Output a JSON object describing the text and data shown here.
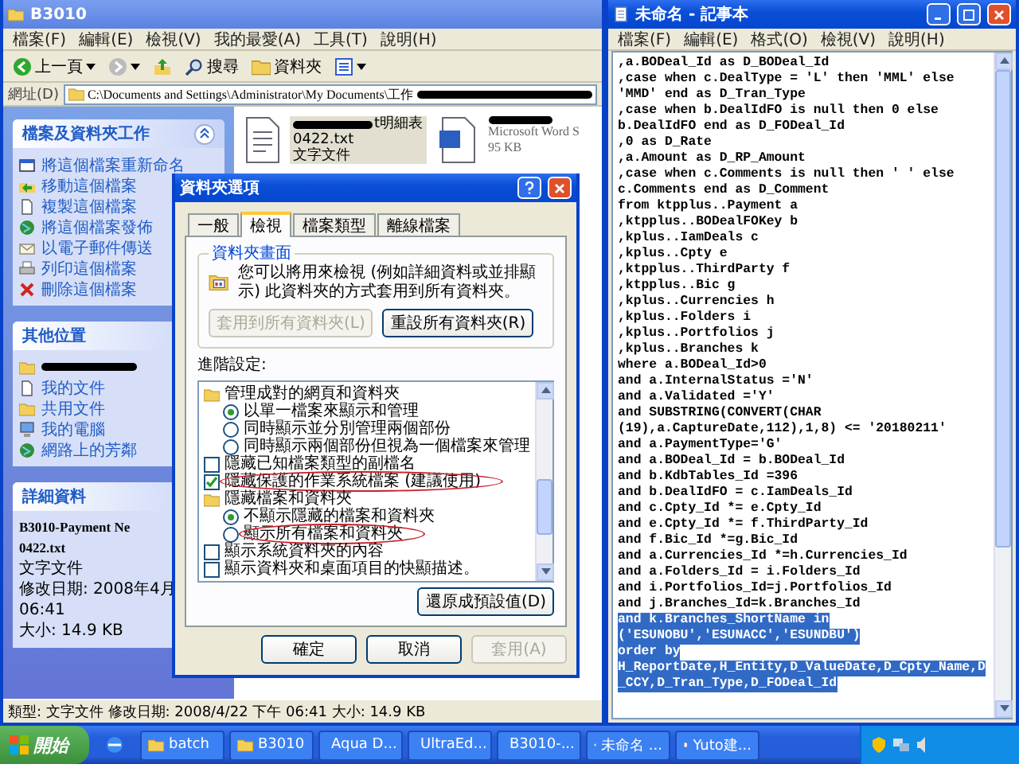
{
  "explorer": {
    "title": "B3010",
    "menu": [
      "檔案(F)",
      "編輯(E)",
      "檢視(V)",
      "我的最愛(A)",
      "工具(T)",
      "說明(H)"
    ],
    "toolbar": {
      "back": "上一頁",
      "search": "搜尋",
      "folders": "資料夾"
    },
    "address": {
      "label": "網址(D)",
      "path": "C:\\Documents and Settings\\Administrator\\My Documents\\工作"
    },
    "tasks_panel": {
      "title": "檔案及資料夾工作",
      "items": [
        {
          "label": "將這個檔案重新命名"
        },
        {
          "label": "移動這個檔案"
        },
        {
          "label": "複製這個檔案"
        },
        {
          "label": "將這個檔案發佈"
        },
        {
          "label": "以電子郵件傳送"
        },
        {
          "label": "列印這個檔案"
        },
        {
          "label": "刪除這個檔案"
        }
      ]
    },
    "other_places": {
      "title": "其他位置",
      "items": [
        {
          "label": "我的文件"
        },
        {
          "label": "共用文件"
        },
        {
          "label": "我的電腦"
        },
        {
          "label": "網路上的芳鄰"
        }
      ]
    },
    "details": {
      "title": "詳細資料",
      "name_lines": [
        "B3010-Payment Ne",
        "0422.txt"
      ],
      "type": "文字文件",
      "modified": [
        "修改日期: 2008年4月",
        "06:41"
      ],
      "size": "大小: 14.9 KB"
    },
    "files": [
      {
        "kind": "text",
        "name_tail": "t明細表",
        "lines": [
          "0422.txt",
          "文字文件"
        ],
        "selected": true
      },
      {
        "kind": "word",
        "lines": [
          "Microsoft Word S",
          "95 KB"
        ],
        "selected": false
      }
    ],
    "status_bar": "類型: 文字文件 修改日期: 2008/4/22 下午 06:41 大小: 14.9 KB"
  },
  "dialog": {
    "title": "資料夾選項",
    "tabs": [
      {
        "label": "一般",
        "selected": false
      },
      {
        "label": "檢視",
        "selected": true
      },
      {
        "label": "檔案類型",
        "selected": false
      },
      {
        "label": "離線檔案",
        "selected": false
      }
    ],
    "group": {
      "title": "資料夾畫面",
      "text": "您可以將用來檢視 (例如詳細資料或並排顯示) 此資料夾的方式套用到所有資料夾。",
      "buttons": [
        {
          "label": "套用到所有資料夾(L)",
          "disabled": true
        },
        {
          "label": "重設所有資料夾(R)",
          "disabled": false
        }
      ]
    },
    "advanced_label": "進階設定:",
    "tree": [
      {
        "kind": "folder",
        "label": "管理成對的網頁和資料夾",
        "children": [
          {
            "kind": "radio",
            "label": "以單一檔案來顯示和管理",
            "selected": true,
            "circled": false
          },
          {
            "kind": "radio",
            "label": "同時顯示並分別管理兩個部份",
            "selected": false,
            "circled": false
          },
          {
            "kind": "radio",
            "label": "同時顯示兩個部份但視為一個檔案來管理",
            "selected": false,
            "circled": false
          }
        ]
      },
      {
        "kind": "checkbox",
        "label": "隱藏已知檔案類型的副檔名",
        "checked": false,
        "circled": false
      },
      {
        "kind": "checkbox",
        "label": "隱藏保護的作業系統檔案 (建議使用)",
        "checked": true,
        "circled": true
      },
      {
        "kind": "folder",
        "label": "隱藏檔案和資料夾",
        "children": [
          {
            "kind": "radio",
            "label": "不顯示隱藏的檔案和資料夾",
            "selected": true,
            "circled": false
          },
          {
            "kind": "radio",
            "label": "顯示所有檔案和資料夾",
            "selected": false,
            "circled": true
          }
        ]
      },
      {
        "kind": "checkbox",
        "label": "顯示系統資料夾的內容",
        "checked": false,
        "circled": false
      },
      {
        "kind": "checkbox",
        "label": "顯示資料夾和桌面項目的快顯描述。",
        "checked": false,
        "circled": false
      }
    ],
    "restore": "還原成預設值(D)",
    "buttons": [
      {
        "label": "確定",
        "disabled": false
      },
      {
        "label": "取消",
        "disabled": false
      },
      {
        "label": "套用(A)",
        "disabled": true
      }
    ]
  },
  "notepad": {
    "title": "未命名 - 記事本",
    "menu": [
      "檔案(F)",
      "編輯(E)",
      "格式(O)",
      "檢視(V)",
      "說明(H)"
    ],
    "lines": [
      {
        "text": ",a.BODeal_Id as D_BODeal_Id",
        "selected": false
      },
      {
        "text": ",case when c.DealType = 'L' then 'MML' else",
        "selected": false
      },
      {
        "text": "'MMD' end as D_Tran_Type",
        "selected": false
      },
      {
        "text": ",case when b.DealIdFO is null then 0 else",
        "selected": false
      },
      {
        "text": "b.DealIdFO end as D_FODeal_Id",
        "selected": false
      },
      {
        "text": ",0 as D_Rate",
        "selected": false
      },
      {
        "text": ",a.Amount as D_RP_Amount",
        "selected": false
      },
      {
        "text": ",case when c.Comments is null then ' ' else",
        "selected": false
      },
      {
        "text": "c.Comments end as D_Comment",
        "selected": false
      },
      {
        "text": "from ktpplus..Payment a",
        "selected": false
      },
      {
        "text": ",ktpplus..BODealFOKey b",
        "selected": false
      },
      {
        "text": ",kplus..IamDeals c",
        "selected": false
      },
      {
        "text": ",kplus..Cpty e",
        "selected": false
      },
      {
        "text": ",ktpplus..ThirdParty f",
        "selected": false
      },
      {
        "text": ",ktpplus..Bic g",
        "selected": false
      },
      {
        "text": ",kplus..Currencies h",
        "selected": false
      },
      {
        "text": ",kplus..Folders i",
        "selected": false
      },
      {
        "text": ",kplus..Portfolios j",
        "selected": false
      },
      {
        "text": ",kplus..Branches k",
        "selected": false
      },
      {
        "text": "where a.BODeal_Id>0",
        "selected": false
      },
      {
        "text": "and a.InternalStatus ='N'",
        "selected": false
      },
      {
        "text": "and a.Validated ='Y'",
        "selected": false
      },
      {
        "text": "and SUBSTRING(CONVERT(CHAR",
        "selected": false
      },
      {
        "text": "(19),a.CaptureDate,112),1,8) <= '20180211'",
        "selected": false
      },
      {
        "text": "and a.PaymentType='G'",
        "selected": false
      },
      {
        "text": "and a.BODeal_Id = b.BODeal_Id",
        "selected": false
      },
      {
        "text": "and b.KdbTables_Id =396",
        "selected": false
      },
      {
        "text": "and b.DealIdFO = c.IamDeals_Id",
        "selected": false
      },
      {
        "text": "and c.Cpty_Id *= e.Cpty_Id",
        "selected": false
      },
      {
        "text": "and e.Cpty_Id *= f.ThirdParty_Id",
        "selected": false
      },
      {
        "text": "and f.Bic_Id *=g.Bic_Id",
        "selected": false
      },
      {
        "text": "and a.Currencies_Id *=h.Currencies_Id",
        "selected": false
      },
      {
        "text": "and a.Folders_Id = i.Folders_Id",
        "selected": false
      },
      {
        "text": "and i.Portfolios_Id=j.Portfolios_Id",
        "selected": false
      },
      {
        "text": "and j.Branches_Id=k.Branches_Id",
        "selected": false
      },
      {
        "text": "and k.Branches_ShortName in",
        "selected": true
      },
      {
        "text": "('ESUNOBU','ESUNACC','ESUNDBU')",
        "selected": true
      },
      {
        "text": "order by",
        "selected": true
      },
      {
        "text": "H_ReportDate,H_Entity,D_ValueDate,D_Cpty_Name,D",
        "selected": true
      },
      {
        "text": "_CCY,D_Tran_Type,D_FODeal_Id",
        "selected": true
      }
    ]
  },
  "taskbar": {
    "start": "開始",
    "tasks": [
      {
        "label": "batch"
      },
      {
        "label": "B3010"
      },
      {
        "label": "Aqua D..."
      },
      {
        "label": "UltraEd..."
      },
      {
        "label": "B3010-..."
      },
      {
        "label": "未命名 ..."
      },
      {
        "label": "Yuto建..."
      }
    ]
  }
}
